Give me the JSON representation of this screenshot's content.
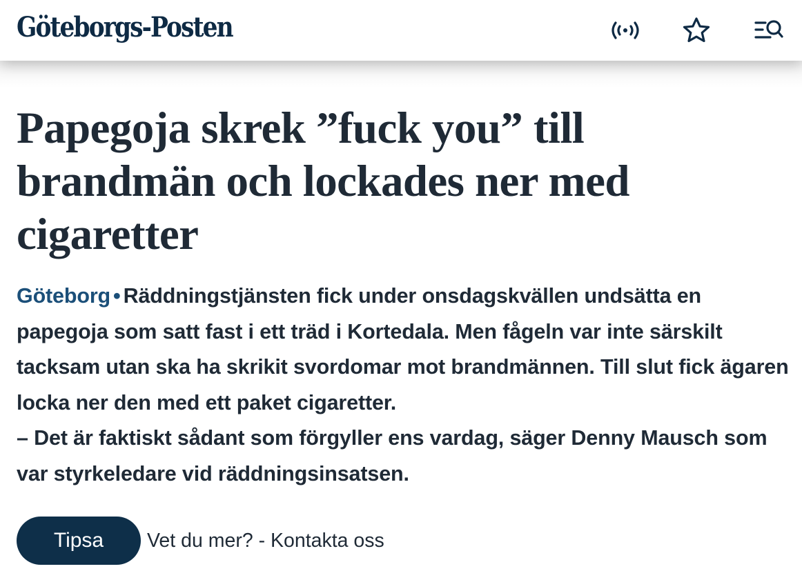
{
  "header": {
    "logo_text": "Göteborgs-Posten",
    "icons": [
      "live-broadcast-icon",
      "star-icon",
      "menu-search-icon"
    ]
  },
  "article": {
    "headline": "Papegoja skrek ”fuck you” till brandmän och lockades ner med cigaretter",
    "location": "Göteborg",
    "separator": "•",
    "lead_paragraph": "Räddningstjänsten fick under onsdagskvällen undsätta en papegoja som satt fast i ett träd i Kortedala. Men fågeln var inte särskilt tacksam utan ska ha skrikit svordomar mot brandmännen. Till slut fick ägaren locka ner den med ett paket cigaretter.",
    "quote_paragraph": "– Det är faktiskt sådant som förgyller ens vardag, säger Denny Mausch som var styrkeledare vid räddningsinsatsen."
  },
  "tips": {
    "button_label": "Tipsa",
    "link_text": "Vet du mer? - Kontakta oss"
  },
  "colors": {
    "brand_navy": "#0e2a44",
    "location_blue": "#1b4f79",
    "button_bg": "#0e2f49",
    "body_text": "#1f2a36"
  }
}
